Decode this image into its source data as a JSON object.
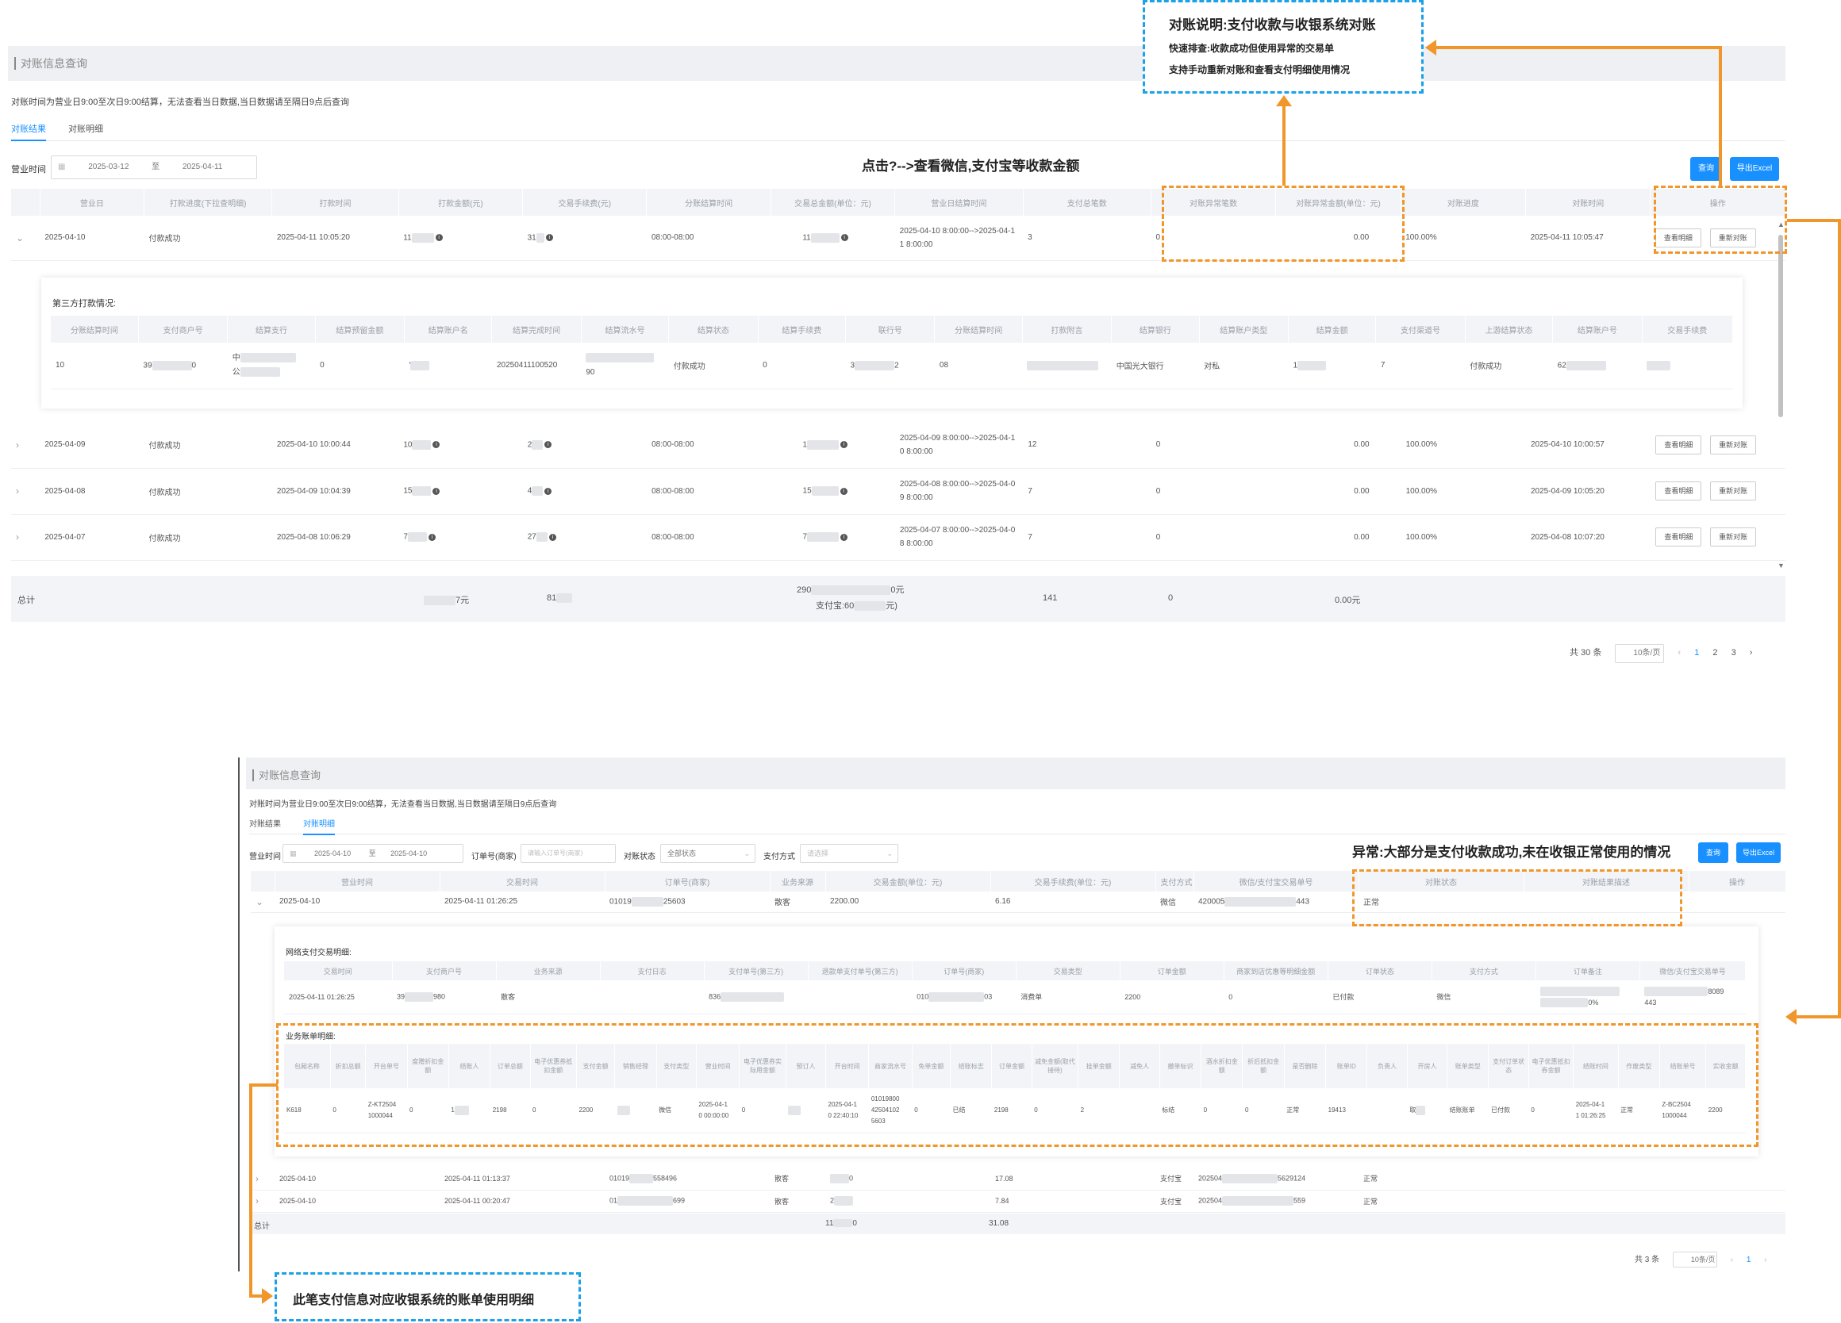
{
  "top": {
    "panel_title": "对账信息查询",
    "notice": "对账时间为营业日9:00至次日9:00结算，无法查看当日数据,当日数据请至隔日9点后查询",
    "tabs": [
      "对账结果",
      "对账明细"
    ],
    "filter_label": "营业时间",
    "date_start": "2025-03-12",
    "date_sep": "至",
    "date_end": "2025-04-11",
    "query_btn": "查询",
    "export_btn": "导出Excel",
    "columns": [
      "营业日",
      "打款进度(下拉查明细)",
      "打款时间",
      "打款金额(元)",
      "交易手续费(元)",
      "分账结算时间",
      "交易总金额(单位：元)",
      "营业日结算时间",
      "支付总笔数",
      "对账异常笔数",
      "对账异常金额(单位：元)",
      "对账进度",
      "对账时间",
      "操作"
    ],
    "rows": [
      {
        "date": "2025-04-10",
        "status": "付款成功",
        "paytime": "2025-04-11 10:05:20",
        "amount": "11",
        "fee": "31",
        "split": "08:00-08:00",
        "total": "11",
        "settle1": "2025-04-10 8:00:00-->2025-04-1",
        "settle2": "1 8:00:00",
        "count": "3",
        "abn": "0",
        "abn_amt": "0.00",
        "progress": "100.00%",
        "recon": "2025-04-11 10:05:47"
      },
      {
        "date": "2025-04-09",
        "status": "付款成功",
        "paytime": "2025-04-10 10:00:44",
        "amount": "10",
        "fee": "2",
        "split": "08:00-08:00",
        "total": "1",
        "settle1": "2025-04-09 8:00:00-->2025-04-1",
        "settle2": "0 8:00:00",
        "count": "12",
        "abn": "0",
        "abn_amt": "0.00",
        "progress": "100.00%",
        "recon": "2025-04-10 10:00:57"
      },
      {
        "date": "2025-04-08",
        "status": "付款成功",
        "paytime": "2025-04-09 10:04:39",
        "amount": "15",
        "fee": "4",
        "split": "08:00-08:00",
        "total": "15",
        "settle1": "2025-04-08 8:00:00-->2025-04-0",
        "settle2": "9 8:00:00",
        "count": "7",
        "abn": "0",
        "abn_amt": "0.00",
        "progress": "100.00%",
        "recon": "2025-04-09 10:05:20"
      },
      {
        "date": "2025-04-07",
        "status": "付款成功",
        "paytime": "2025-04-08 10:06:29",
        "amount": "7",
        "fee": "27",
        "split": "08:00-08:00",
        "total": "7",
        "settle1": "2025-04-07 8:00:00-->2025-04-0",
        "settle2": "8 8:00:00",
        "count": "7",
        "abn": "0",
        "abn_amt": "0.00",
        "progress": "100.00%",
        "recon": "2025-04-08 10:07:20"
      }
    ],
    "row_view_btn": "查看明细",
    "row_recon_btn": "重新对账",
    "total_row": {
      "label": "总计",
      "amount": "7元",
      "fee": "81",
      "total1": "290",
      "total1_suffix": "0元",
      "total2": "支付宝:60",
      "total2_suffix": "元)",
      "count": "141",
      "abn": "0",
      "abn_amt": "0.00元"
    },
    "sub_title": "第三方打款情况:",
    "sub_columns": [
      "分账结算时间",
      "支付商户号",
      "结算支行",
      "结算预留金额",
      "结算账户名",
      "结算完成时间",
      "结算流水号",
      "结算状态",
      "结算手续费",
      "联行号",
      "分账结算时间",
      "打款附言",
      "结算银行",
      "结算账户类型",
      "结算金额",
      "支付渠道号",
      "上游结算状态",
      "结算账户号",
      "交易手续费"
    ],
    "sub_row": {
      "c1": "10",
      "c2": "39",
      "c2b": "0",
      "c3": "中",
      "c3b": "公",
      "c4": "0",
      "c5": "'",
      "c6": "20250411100520",
      "c7b": "90",
      "c8": "付款成功",
      "c9": "0",
      "c10": "3",
      "c10b": "2",
      "c11": "08",
      "c13": "中国光大银行",
      "c14": "对私",
      "c15": "1",
      "c16": "7",
      "c17": "付款成功",
      "c18": "62"
    },
    "pagination": {
      "total": "共 30 条",
      "per_page": "10条/页",
      "pages": [
        "1",
        "2",
        "3"
      ]
    }
  },
  "bottom": {
    "panel_title": "对账信息查询",
    "notice": "对账时间为营业日9:00至次日9:00结算，无法查看当日数据,当日数据请至隔日9点后查询",
    "tabs": [
      "对账结果",
      "对账明细"
    ],
    "f_time_label": "营业时间",
    "date_start": "2025-04-10",
    "date_sep": "至",
    "date_end": "2025-04-10",
    "f_order_label": "订单号(商家)",
    "f_order_ph": "请输入订单号(商家)",
    "f_status_label": "对账状态",
    "f_status_val": "全部状态",
    "f_pay_label": "支付方式",
    "f_pay_ph": "请选择",
    "query_btn": "查询",
    "export_btn": "导出Excel",
    "columns": [
      "营业时间",
      "交易时间",
      "订单号(商家)",
      "业务来源",
      "交易金额(单位：元)",
      "交易手续费(单位：元)",
      "支付方式",
      "微信/支付宝交易单号",
      "对账状态",
      "对账结果描述",
      "操作"
    ],
    "main_row": {
      "date": "2025-04-10",
      "time": "2025-04-11 01:26:25",
      "order": "01019",
      "order_b": "25603",
      "src": "散客",
      "amt": "2200.00",
      "fee": "6.16",
      "pay": "微信",
      "txn": "420005",
      "txn_b": "443",
      "status": "正常"
    },
    "sub1_title": "网络支付交易明细:",
    "sub1_columns": [
      "交易时间",
      "支付商户号",
      "业务来源",
      "支付日志",
      "支付单号(第三方)",
      "退款单支付单号(第三方)",
      "订单号(商家)",
      "交易类型",
      "订单金额",
      "商家到店优惠等明细金额",
      "订单状态",
      "支付方式",
      "订单备注",
      "微信/支付宝交易单号"
    ],
    "sub1_row": {
      "time": "2025-04-11 01:26:25",
      "merchant": "39",
      "merchant_b": "980",
      "src": "散客",
      "pay_no": "836",
      "order": "010",
      "order_b": "03",
      "type": "消费单",
      "amt": "2200",
      "disc": "0",
      "status": "已付款",
      "way": "微信",
      "txn_b": "8089",
      "txn_c": "443",
      "remark_b": "0%"
    },
    "sub2_title": "业务账单明细:",
    "sub2_columns": [
      "包厢名称",
      "折扣总额",
      "开台单号",
      "度赠折扣金额",
      "结账人",
      "订单总额",
      "电子优惠券抵扣金额",
      "支付金额",
      "销售经理",
      "支付类型",
      "营业时间",
      "电子优惠券实际用金额",
      "预订人",
      "开台时间",
      "商家流水号",
      "免单金额",
      "结账标志",
      "订单金额",
      "减免金额(取代接待)",
      "挂单金额",
      "减免人",
      "撤单标识",
      "酒水折扣金额",
      "折后抵扣金额",
      "是否删除",
      "账单ID",
      "负责人",
      "开房人",
      "账单类型",
      "支付订单状态",
      "电子优惠抵扣券金额",
      "结账时间",
      "作废类型",
      "结账单号",
      "实收金额"
    ],
    "sub2_row": {
      "room": "K618",
      "disc": "0",
      "open_no": "Z-KT2504",
      "open_no_b": "1000044",
      "gift": "0",
      "cashier": "1",
      "order_total": "2198",
      "coupon": "0",
      "pay": "2200",
      "ptype": "微信",
      "btime": "2025-04-1",
      "btime_b": "0 00:00:00",
      "ecoupon": "0",
      "open_time": "2025-04-1",
      "open_time_b": "0 22:40:10",
      "serial": "01019800",
      "serial_b": "42504102",
      "serial_c": "5603",
      "free": "0",
      "flag": "已结",
      "order_amt": "2198",
      "reduce": "0",
      "hang": "2",
      "cancel": "标结",
      "wine": "0",
      "after": "0",
      "del": "正常",
      "bill_id": "19413",
      "open_by": "取",
      "btype": "结账账单",
      "pstatus": "已付款",
      "ecoupon2": "0",
      "ctime": "2025-04-1",
      "ctime_b": "1 01:26:25",
      "cno": "Z-BC2504",
      "cno_b": "1000044",
      "real": "2200",
      "void": "正常"
    },
    "rows2": [
      {
        "date": "2025-04-10",
        "time": "2025-04-11 01:13:37",
        "order": "01019",
        "order_b": "558496",
        "src": "散客",
        "amt": "0",
        "fee": "17.08",
        "pay": "支付宝",
        "txn": "202504",
        "txn_b": "5629124",
        "status": "正常"
      },
      {
        "date": "2025-04-10",
        "time": "2025-04-11 00:20:47",
        "order": "01",
        "order_b": "699",
        "src": "散客",
        "amt": "2",
        "fee": "7.84",
        "pay": "支付宝",
        "txn": "202504",
        "txn_b": "559",
        "status": "正常"
      }
    ],
    "total_row": {
      "label": "总计",
      "amt": "11",
      "amt_b": "0",
      "fee": "31.08"
    },
    "pagination": {
      "total": "共 3 条",
      "per_page": "10条/页",
      "pages": [
        "1"
      ]
    }
  },
  "notes": {
    "blue_title": "对账说明:支付收款与收银系统对账",
    "blue_line1": "快速排查:收款成功但使用异常的交易单",
    "blue_line2": "支持手动重新对账和查看支付明细使用情况",
    "click_note": "点击?-->查看微信,支付宝等收款金额",
    "abnormal_note": "异常:大部分是支付收款成功,未在收银正常使用的情况",
    "bottom_note": "此笔支付信息对应收银系统的账单使用明细"
  },
  "colors": {
    "accent": "#1890ff",
    "annotation_orange": "#f0962a",
    "annotation_blue": "#1aa1e8"
  }
}
